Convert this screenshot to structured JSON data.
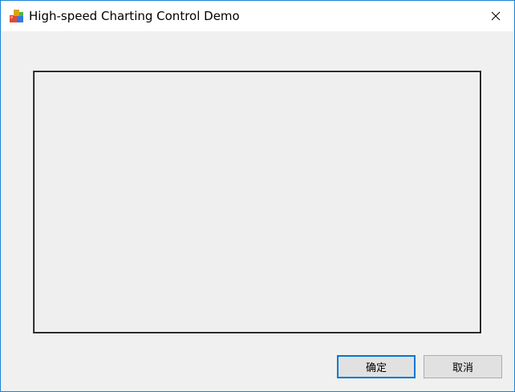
{
  "window": {
    "title": "High-speed Charting Control Demo",
    "app_icon": "app-icon",
    "close_icon": "close-icon"
  },
  "chart": {
    "content": ""
  },
  "buttons": {
    "ok_label": "确定",
    "cancel_label": "取消"
  },
  "colors": {
    "window_border": "#1883d7",
    "dialog_background": "#f0f0f0",
    "default_button_border": "#0078d7"
  }
}
